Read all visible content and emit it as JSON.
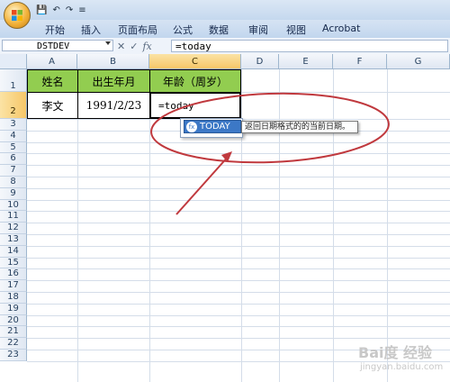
{
  "quick_access": {
    "save": "💾",
    "undo": "↶",
    "redo": "↷",
    "customize": "≡"
  },
  "ribbon": {
    "tabs": [
      "开始",
      "插入",
      "页面布局",
      "公式",
      "数据",
      "审阅",
      "视图",
      "Acrobat"
    ]
  },
  "formula_bar": {
    "name_box": "DSTDEV",
    "cancel": "✕",
    "enter": "✓",
    "fx": "fx",
    "formula": "=today"
  },
  "columns": [
    "A",
    "B",
    "C",
    "D",
    "E",
    "F",
    "G"
  ],
  "rows": [
    "1",
    "2",
    "3",
    "4",
    "5",
    "6",
    "7",
    "8",
    "9",
    "10",
    "11",
    "12",
    "13",
    "14",
    "15",
    "16",
    "17",
    "18",
    "19",
    "20",
    "21",
    "22",
    "23"
  ],
  "table": {
    "headers": [
      "姓名",
      "出生年月",
      "年龄（周岁）"
    ],
    "row": [
      "李文",
      "1991/2/23",
      "=today"
    ]
  },
  "autocomplete": {
    "item": "TODAY",
    "icon": "fx",
    "tooltip": "返回日期格式的的当前日期。"
  },
  "annotation": {
    "color": "#c0393e"
  },
  "watermark": {
    "main": "Bai度 经验",
    "sub": "jingyan.baidu.com"
  }
}
